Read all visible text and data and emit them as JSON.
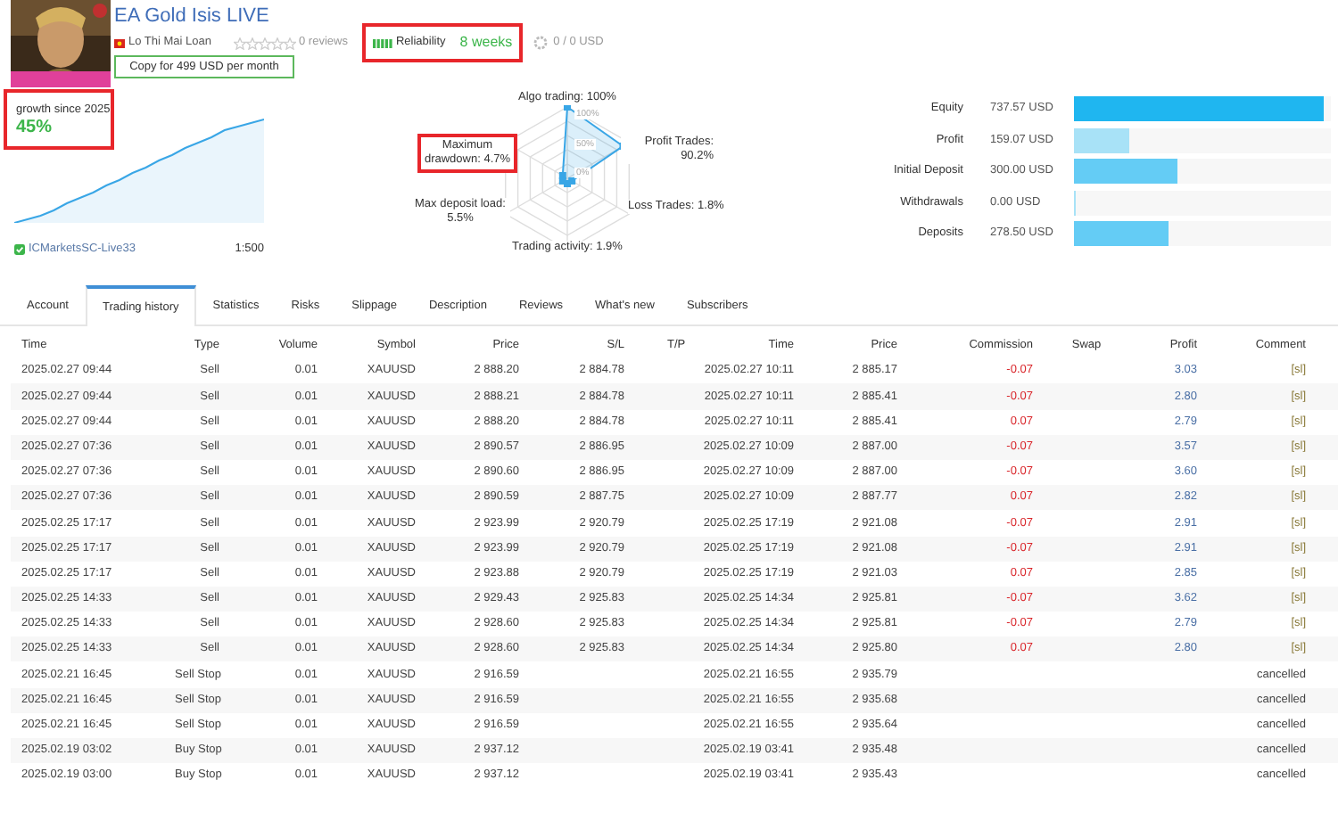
{
  "profile": {
    "title": "EA Gold Isis LIVE",
    "author": "Lo Thi Mai Loan",
    "stars": 0,
    "reviews": "0 reviews",
    "reliability_label": "Reliability",
    "reliability_value": "8 weeks",
    "funds": "0 / 0 USD",
    "copy_button": "Copy for 499 USD per month"
  },
  "growth": {
    "label": "growth since 2025",
    "value": "45%"
  },
  "broker": {
    "server": "ICMarketsSC-Live33",
    "leverage": "1:500"
  },
  "radar": {
    "rings": [
      "100%",
      "50%",
      "0%"
    ],
    "axes": [
      {
        "label": "Algo trading: 100%"
      },
      {
        "label": "Maximum drawdown: 4.7%"
      },
      {
        "label": "Profit Trades: 90.2%"
      },
      {
        "label": "Max deposit load: 5.5%"
      },
      {
        "label": "Loss Trades: 1.8%"
      },
      {
        "label": "Trading activity: 1.9%"
      }
    ]
  },
  "stats": [
    {
      "label": "Equity",
      "value": "737.57 USD",
      "level": 0.97,
      "color": "#1fb6f0"
    },
    {
      "label": "Profit",
      "value": "159.07 USD",
      "level": 0.215,
      "color": "#a8e2f7"
    },
    {
      "label": "Initial Deposit",
      "value": "300.00 USD",
      "level": 0.4,
      "color": "#64ccf5"
    },
    {
      "label": "Withdrawals",
      "value": "0.00 USD",
      "level": 0.01,
      "color": "#a8e2f7"
    },
    {
      "label": "Deposits",
      "value": "278.50 USD",
      "level": 0.37,
      "color": "#64ccf5"
    }
  ],
  "tabs": [
    {
      "label": "Account",
      "selected": false
    },
    {
      "label": "Trading history",
      "selected": true
    },
    {
      "label": "Statistics",
      "selected": false
    },
    {
      "label": "Risks",
      "selected": false
    },
    {
      "label": "Slippage",
      "selected": false
    },
    {
      "label": "Description",
      "selected": false
    },
    {
      "label": "Reviews",
      "selected": false
    },
    {
      "label": "What's new",
      "selected": false
    },
    {
      "label": "Subscribers",
      "selected": false
    }
  ],
  "table": {
    "columns": [
      "Time",
      "Type",
      "Volume",
      "Symbol",
      "Price",
      "S/L",
      "T/P",
      "Time",
      "Price",
      "Commission",
      "Swap",
      "Profit",
      "Comment"
    ],
    "rows": [
      {
        "time": "2025.02.27 09:44",
        "type": "Sell",
        "volume": "0.01",
        "symbol": "XAUUSD",
        "price": "2 888.20",
        "sl": "2 884.78",
        "close_time": "2025.02.27 10:11",
        "close_price": "2 885.17",
        "commission": "-0.07",
        "profit": "3.03",
        "comment": "[sl]"
      },
      {
        "time": "2025.02.27 09:44",
        "type": "Sell",
        "volume": "0.01",
        "symbol": "XAUUSD",
        "price": "2 888.21",
        "sl": "2 884.78",
        "close_time": "2025.02.27 10:11",
        "close_price": "2 885.41",
        "commission": "-0.07",
        "profit": "2.80",
        "comment": "[sl]"
      },
      {
        "time": "2025.02.27 09:44",
        "type": "Sell",
        "volume": "0.01",
        "symbol": "XAUUSD",
        "price": "2 888.20",
        "sl": "2 884.78",
        "close_time": "2025.02.27 10:11",
        "close_price": "2 885.41",
        "commission": "0.07",
        "profit": "2.79",
        "comment": "[sl]"
      },
      {
        "time": "2025.02.27 07:36",
        "type": "Sell",
        "volume": "0.01",
        "symbol": "XAUUSD",
        "price": "2 890.57",
        "sl": "2 886.95",
        "close_time": "2025.02.27 10:09",
        "close_price": "2 887.00",
        "commission": "-0.07",
        "profit": "3.57",
        "comment": "[sl]"
      },
      {
        "time": "2025.02.27 07:36",
        "type": "Sell",
        "volume": "0.01",
        "symbol": "XAUUSD",
        "price": "2 890.60",
        "sl": "2 886.95",
        "close_time": "2025.02.27 10:09",
        "close_price": "2 887.00",
        "commission": "-0.07",
        "profit": "3.60",
        "comment": "[sl]"
      },
      {
        "time": "2025.02.27 07:36",
        "type": "Sell",
        "volume": "0.01",
        "symbol": "XAUUSD",
        "price": "2 890.59",
        "sl": "2 887.75",
        "close_time": "2025.02.27 10:09",
        "close_price": "2 887.77",
        "commission": "0.07",
        "profit": "2.82",
        "comment": "[sl]"
      },
      {
        "time": "2025.02.25 17:17",
        "type": "Sell",
        "volume": "0.01",
        "symbol": "XAUUSD",
        "price": "2 923.99",
        "sl": "2 920.79",
        "close_time": "2025.02.25 17:19",
        "close_price": "2 921.08",
        "commission": "-0.07",
        "profit": "2.91",
        "comment": "[sl]"
      },
      {
        "time": "2025.02.25 17:17",
        "type": "Sell",
        "volume": "0.01",
        "symbol": "XAUUSD",
        "price": "2 923.99",
        "sl": "2 920.79",
        "close_time": "2025.02.25 17:19",
        "close_price": "2 921.08",
        "commission": "-0.07",
        "profit": "2.91",
        "comment": "[sl]"
      },
      {
        "time": "2025.02.25 17:17",
        "type": "Sell",
        "volume": "0.01",
        "symbol": "XAUUSD",
        "price": "2 923.88",
        "sl": "2 920.79",
        "close_time": "2025.02.25 17:19",
        "close_price": "2 921.03",
        "commission": "0.07",
        "profit": "2.85",
        "comment": "[sl]"
      },
      {
        "time": "2025.02.25 14:33",
        "type": "Sell",
        "volume": "0.01",
        "symbol": "XAUUSD",
        "price": "2 929.43",
        "sl": "2 925.83",
        "close_time": "2025.02.25 14:34",
        "close_price": "2 925.81",
        "commission": "-0.07",
        "profit": "3.62",
        "comment": "[sl]"
      },
      {
        "time": "2025.02.25 14:33",
        "type": "Sell",
        "volume": "0.01",
        "symbol": "XAUUSD",
        "price": "2 928.60",
        "sl": "2 925.83",
        "close_time": "2025.02.25 14:34",
        "close_price": "2 925.81",
        "commission": "-0.07",
        "profit": "2.79",
        "comment": "[sl]"
      },
      {
        "time": "2025.02.25 14:33",
        "type": "Sell",
        "volume": "0.01",
        "symbol": "XAUUSD",
        "price": "2 928.60",
        "sl": "2 925.83",
        "close_time": "2025.02.25 14:34",
        "close_price": "2 925.80",
        "commission": "0.07",
        "profit": "2.80",
        "comment": "[sl]"
      },
      {
        "time": "2025.02.21 16:45",
        "type": "Sell Stop",
        "volume": "0.01",
        "symbol": "XAUUSD",
        "price": "2 916.59",
        "close_time": "2025.02.21 16:55",
        "close_price": "2 935.79",
        "comment": "cancelled"
      },
      {
        "time": "2025.02.21 16:45",
        "type": "Sell Stop",
        "volume": "0.01",
        "symbol": "XAUUSD",
        "price": "2 916.59",
        "close_time": "2025.02.21 16:55",
        "close_price": "2 935.68",
        "comment": "cancelled"
      },
      {
        "time": "2025.02.21 16:45",
        "type": "Sell Stop",
        "volume": "0.01",
        "symbol": "XAUUSD",
        "price": "2 916.59",
        "close_time": "2025.02.21 16:55",
        "close_price": "2 935.64",
        "comment": "cancelled"
      },
      {
        "time": "2025.02.19 03:02",
        "type": "Buy Stop",
        "volume": "0.01",
        "symbol": "XAUUSD",
        "price": "2 937.12",
        "close_time": "2025.02.19 03:41",
        "close_price": "2 935.48",
        "comment": "cancelled"
      },
      {
        "time": "2025.02.19 03:00",
        "type": "Buy Stop",
        "volume": "0.01",
        "symbol": "XAUUSD",
        "price": "2 937.12",
        "close_time": "2025.02.19 03:41",
        "close_price": "2 935.43",
        "comment": "cancelled"
      }
    ]
  }
}
